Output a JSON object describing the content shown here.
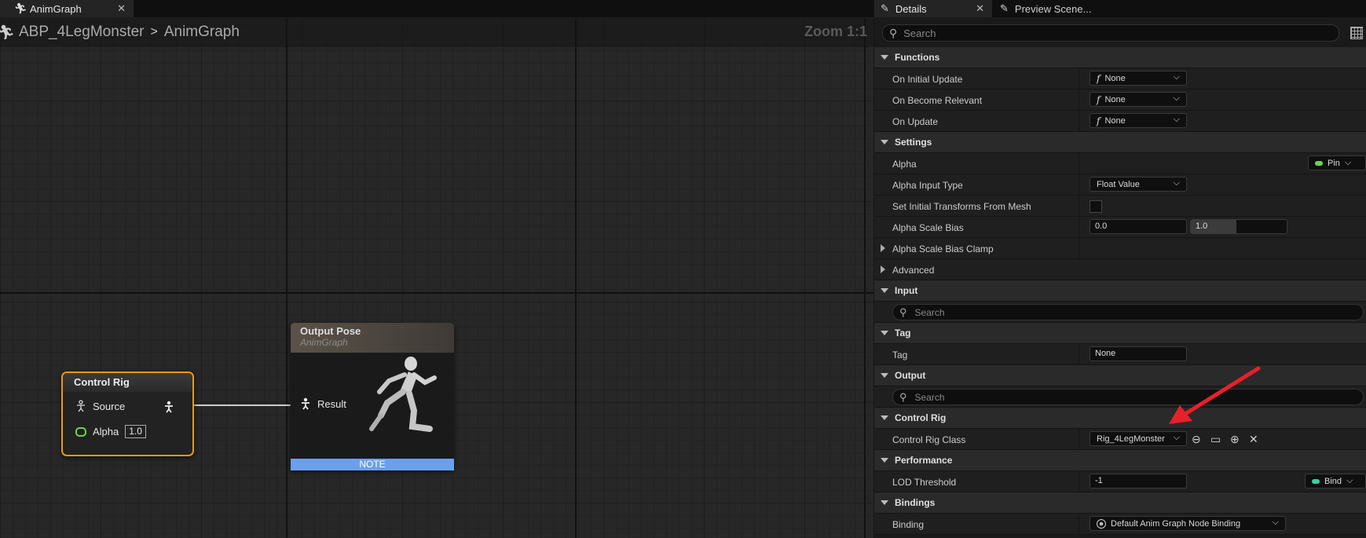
{
  "graph": {
    "tab_label": "AnimGraph",
    "tab_close": "✕",
    "breadcrumb": [
      "ABP_4LegMonster",
      "AnimGraph"
    ],
    "breadcrumb_sep": ">",
    "zoom": "Zoom 1:1"
  },
  "nodes": {
    "control_rig": {
      "title": "Control Rig",
      "source_label": "Source",
      "alpha_label": "Alpha",
      "alpha_value": "1.0"
    },
    "output_pose": {
      "title": "Output Pose",
      "subtitle": "AnimGraph",
      "result_label": "Result",
      "note": "NOTE"
    }
  },
  "details": {
    "tab_label": "Details",
    "tab_close": "✕",
    "tab2_label": "Preview Scene...",
    "search_placeholder": "Search",
    "categories": {
      "functions": "Functions",
      "settings": "Settings",
      "input": "Input",
      "tag": "Tag",
      "output": "Output",
      "control_rig": "Control Rig",
      "performance": "Performance",
      "bindings": "Bindings"
    },
    "rows": {
      "on_initial_update": {
        "label": "On Initial Update",
        "value": "None"
      },
      "on_become_relevant": {
        "label": "On Become Relevant",
        "value": "None"
      },
      "on_update": {
        "label": "On Update",
        "value": "None"
      },
      "alpha": {
        "label": "Alpha",
        "pin": "Pin"
      },
      "alpha_input_type": {
        "label": "Alpha Input Type",
        "value": "Float Value"
      },
      "set_initial_transforms": {
        "label": "Set Initial Transforms From Mesh"
      },
      "alpha_scale_bias": {
        "label": "Alpha Scale Bias",
        "min": "0.0",
        "max": "1.0"
      },
      "alpha_scale_bias_clamp": {
        "label": "Alpha Scale Bias Clamp"
      },
      "advanced": {
        "label": "Advanced"
      },
      "input_search": "Search",
      "tag": {
        "label": "Tag",
        "value": "None"
      },
      "output_search": "Search",
      "control_rig_class": {
        "label": "Control Rig Class",
        "value": "Rig_4LegMonster"
      },
      "lod_threshold": {
        "label": "LOD Threshold",
        "value": "-1",
        "pin": "Bind"
      },
      "binding": {
        "label": "Binding",
        "value": "Default Anim Graph Node Binding"
      }
    }
  },
  "colors": {
    "selected_node_border": "#e89a14",
    "alpha_pin": "#6fd34f",
    "note_bar": "#6ca0ec",
    "arrow": "#e8202a"
  }
}
